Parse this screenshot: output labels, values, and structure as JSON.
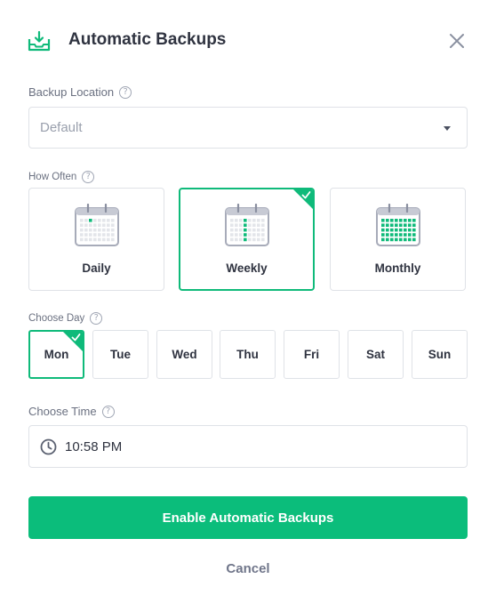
{
  "header": {
    "title": "Automatic Backups",
    "icon": "download-tray-icon",
    "close_icon": "close-icon",
    "accent": "#0fba7a"
  },
  "location": {
    "label": "Backup Location",
    "value": "Default"
  },
  "frequency": {
    "label": "How Often",
    "options": [
      {
        "label": "Daily",
        "selected": false
      },
      {
        "label": "Weekly",
        "selected": true
      },
      {
        "label": "Monthly",
        "selected": false
      }
    ]
  },
  "day": {
    "label": "Choose Day",
    "options": [
      {
        "label": "Mon",
        "selected": true
      },
      {
        "label": "Tue",
        "selected": false
      },
      {
        "label": "Wed",
        "selected": false
      },
      {
        "label": "Thu",
        "selected": false
      },
      {
        "label": "Fri",
        "selected": false
      },
      {
        "label": "Sat",
        "selected": false
      },
      {
        "label": "Sun",
        "selected": false
      }
    ]
  },
  "time": {
    "label": "Choose Time",
    "value": "10:58 PM",
    "icon": "clock-icon"
  },
  "actions": {
    "primary": "Enable Automatic Backups",
    "cancel": "Cancel"
  }
}
